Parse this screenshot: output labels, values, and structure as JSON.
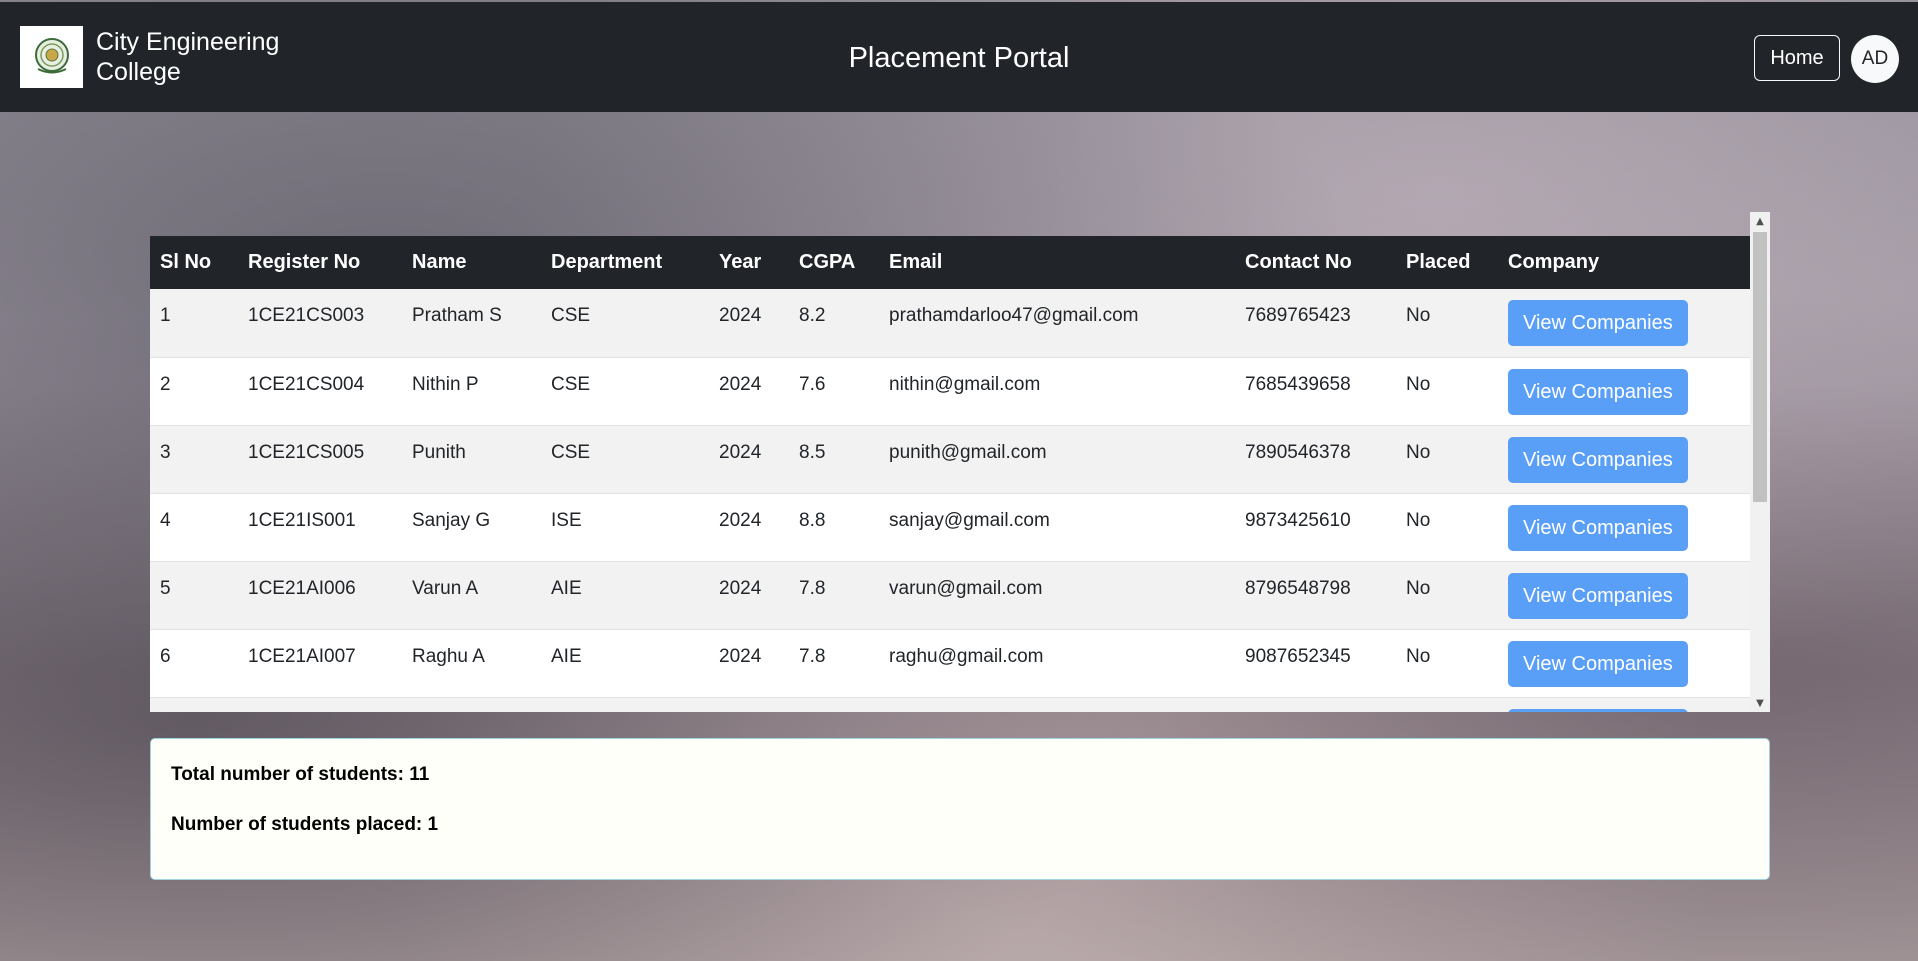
{
  "header": {
    "college_name": "City Engineering College",
    "page_title": "Placement Portal",
    "home_label": "Home",
    "avatar_initials": "AD"
  },
  "table": {
    "columns": [
      "Sl No",
      "Register No",
      "Name",
      "Department",
      "Year",
      "CGPA",
      "Email",
      "Contact No",
      "Placed",
      "Company"
    ],
    "button_label": "View Companies",
    "rows": [
      [
        "1",
        "1CE21CS003",
        "Pratham S",
        "CSE",
        "2024",
        "8.2",
        "prathamdarloo47@gmail.com",
        "7689765423",
        "No"
      ],
      [
        "2",
        "1CE21CS004",
        "Nithin P",
        "CSE",
        "2024",
        "7.6",
        "nithin@gmail.com",
        "7685439658",
        "No"
      ],
      [
        "3",
        "1CE21CS005",
        "Punith",
        "CSE",
        "2024",
        "8.5",
        "punith@gmail.com",
        "7890546378",
        "No"
      ],
      [
        "4",
        "1CE21IS001",
        "Sanjay G",
        "ISE",
        "2024",
        "8.8",
        "sanjay@gmail.com",
        "9873425610",
        "No"
      ],
      [
        "5",
        "1CE21AI006",
        "Varun A",
        "AIE",
        "2024",
        "7.8",
        "varun@gmail.com",
        "8796548798",
        "No"
      ],
      [
        "6",
        "1CE21AI007",
        "Raghu A",
        "AIE",
        "2024",
        "7.8",
        "raghu@gmail.com",
        "9087652345",
        "No"
      ]
    ]
  },
  "summary": {
    "total_students": "Total number of students: 11",
    "students_placed": "Number of students placed: 1"
  }
}
